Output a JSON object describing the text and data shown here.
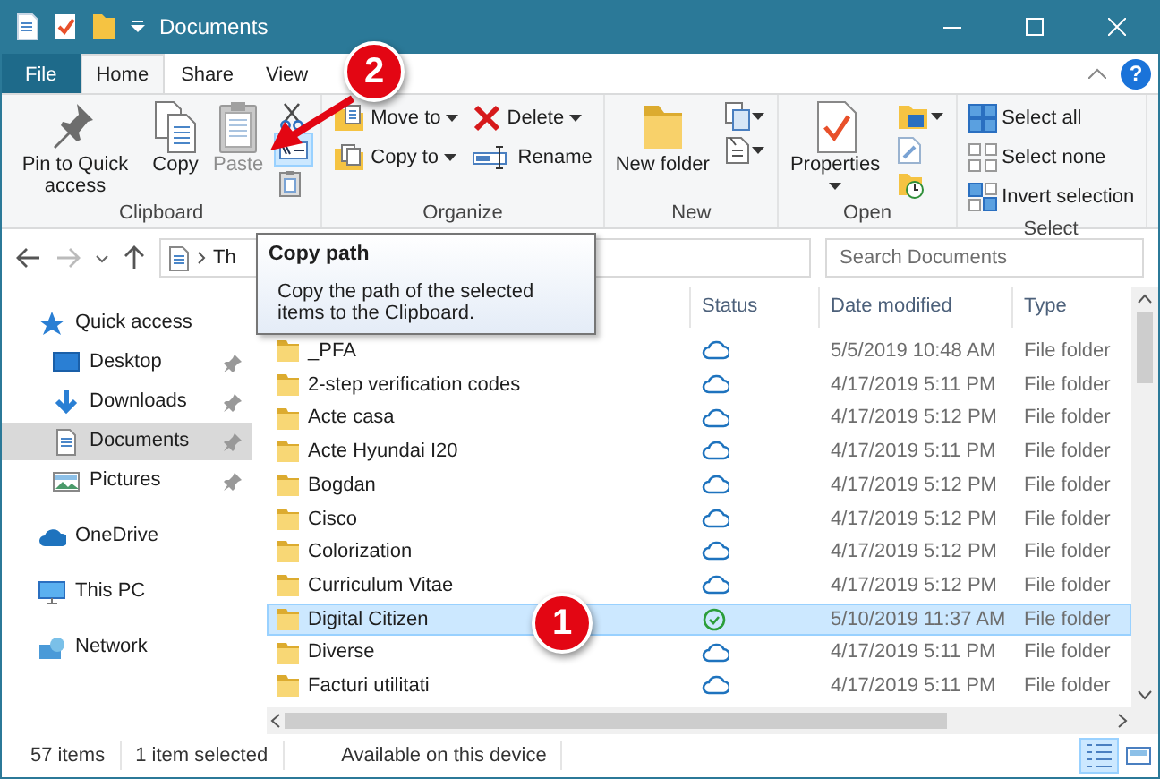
{
  "window": {
    "title": "Documents"
  },
  "ribbon_tabs": [
    {
      "label": "File",
      "selected": false,
      "kind": "file"
    },
    {
      "label": "Home",
      "selected": true,
      "kind": "tab"
    },
    {
      "label": "Share",
      "selected": false,
      "kind": "tab"
    },
    {
      "label": "View",
      "selected": false,
      "kind": "tab"
    }
  ],
  "ribbon_help": "?",
  "ribbon_groups": [
    {
      "title": "Clipboard",
      "columns": [
        [
          {
            "kind": "large",
            "label": "Pin to Quick access"
          }
        ],
        [
          {
            "kind": "large",
            "label": "Copy"
          }
        ],
        [
          {
            "kind": "large",
            "label": "Paste",
            "disabled": true
          }
        ],
        [
          {
            "kind": "icon",
            "highlighted": false
          },
          {
            "kind": "icon",
            "highlighted": true
          },
          {
            "kind": "icon",
            "highlighted": false
          }
        ]
      ]
    },
    {
      "title": "Organize",
      "columns": [
        [
          {
            "kind": "small",
            "label": "Move to",
            "dropdown": true
          },
          {
            "kind": "small",
            "label": "Copy to",
            "dropdown": true
          }
        ],
        [
          {
            "kind": "small",
            "label": "Delete",
            "dropdown": true
          },
          {
            "kind": "small",
            "label": "Rename"
          }
        ]
      ]
    },
    {
      "title": "New",
      "columns": [
        [
          {
            "kind": "large",
            "label": "New folder"
          }
        ],
        [
          {
            "kind": "icon",
            "dropdown": true
          },
          {
            "kind": "icon",
            "dropdown": true
          }
        ]
      ]
    },
    {
      "title": "Open",
      "columns": [
        [
          {
            "kind": "large",
            "label": "Properties",
            "dropdown": true
          }
        ],
        [
          {
            "kind": "icon",
            "dropdown": true
          },
          {
            "kind": "icon"
          },
          {
            "kind": "icon"
          }
        ]
      ]
    },
    {
      "title": "Select",
      "columns": [
        [
          {
            "kind": "small",
            "label": "Select all"
          },
          {
            "kind": "small",
            "label": "Select none"
          },
          {
            "kind": "small",
            "label": "Invert selection"
          }
        ]
      ]
    }
  ],
  "address": {
    "path": "Th",
    "search_placeholder": "Search Documents"
  },
  "tooltip": {
    "title": "Copy path",
    "text": "Copy the path of the selected items to the Clipboard."
  },
  "sidebar": {
    "items": [
      {
        "label": "Quick access",
        "selected": false,
        "children": [
          {
            "label": "Desktop",
            "selected": false,
            "pinned": true
          },
          {
            "label": "Downloads",
            "selected": false,
            "pinned": true
          },
          {
            "label": "Documents",
            "selected": true,
            "pinned": true
          },
          {
            "label": "Pictures",
            "selected": false,
            "pinned": true
          }
        ]
      },
      {
        "label": "OneDrive",
        "selected": false
      },
      {
        "label": "This PC",
        "selected": false
      },
      {
        "label": "Network",
        "selected": false
      }
    ]
  },
  "table": {
    "columns": [
      "Status",
      "Date modified",
      "Type"
    ],
    "rows": [
      {
        "name": "_PFA",
        "synced": false,
        "date": "5/5/2019 10:48 AM",
        "type": "File folder",
        "selected": false
      },
      {
        "name": "2-step verification codes",
        "synced": false,
        "date": "4/17/2019 5:11 PM",
        "type": "File folder",
        "selected": false
      },
      {
        "name": "Acte casa",
        "synced": false,
        "date": "4/17/2019 5:12 PM",
        "type": "File folder",
        "selected": false
      },
      {
        "name": "Acte Hyundai I20",
        "synced": false,
        "date": "4/17/2019 5:11 PM",
        "type": "File folder",
        "selected": false
      },
      {
        "name": "Bogdan",
        "synced": false,
        "date": "4/17/2019 5:12 PM",
        "type": "File folder",
        "selected": false
      },
      {
        "name": "Cisco",
        "synced": false,
        "date": "4/17/2019 5:12 PM",
        "type": "File folder",
        "selected": false
      },
      {
        "name": "Colorization",
        "synced": false,
        "date": "4/17/2019 5:12 PM",
        "type": "File folder",
        "selected": false
      },
      {
        "name": "Curriculum Vitae",
        "synced": false,
        "date": "4/17/2019 5:12 PM",
        "type": "File folder",
        "selected": false
      },
      {
        "name": "Digital Citizen",
        "synced": true,
        "date": "5/10/2019 11:37 AM",
        "type": "File folder",
        "selected": true
      },
      {
        "name": "Diverse",
        "synced": false,
        "date": "4/17/2019 5:11 PM",
        "type": "File folder",
        "selected": false
      },
      {
        "name": "Facturi utilitati",
        "synced": false,
        "date": "4/17/2019 5:11 PM",
        "type": "File folder",
        "selected": false
      }
    ]
  },
  "status_bar": {
    "texts": [
      "57 items",
      "1 item selected",
      "Available on this device"
    ],
    "views": [
      {
        "selected": true
      },
      {
        "selected": false
      }
    ]
  },
  "annotations": [
    {
      "label": "2"
    },
    {
      "label": "1"
    }
  ]
}
